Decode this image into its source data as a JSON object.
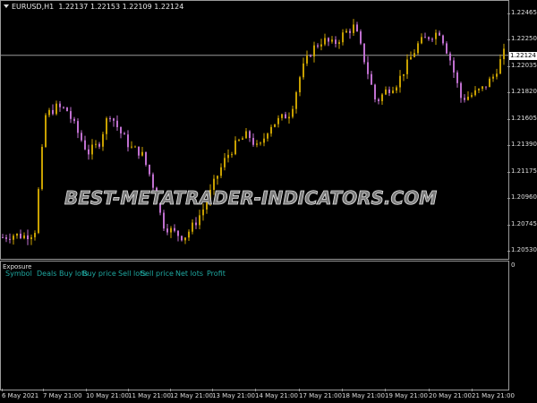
{
  "chart_data": {
    "type": "candlestick",
    "title": "EURUSD,H1",
    "ohlc_readout": [
      "1.22137",
      "1.22153",
      "1.22109",
      "1.22124"
    ],
    "current_price": "1.22124",
    "y_ticks": [
      "1.22465",
      "1.22250",
      "1.22035",
      "1.21820",
      "1.21605",
      "1.21390",
      "1.21175",
      "1.20960",
      "1.20745",
      "1.20530"
    ],
    "ylim": [
      1.2053,
      1.22465
    ],
    "x_ticks": [
      "6 May 2021",
      "7 May 21:00",
      "10 May 21:00",
      "11 May 21:00",
      "12 May 21:00",
      "13 May 21:00",
      "14 May 21:00",
      "17 May 21:00",
      "18 May 21:00",
      "19 May 21:00",
      "20 May 21:00",
      "21 May 21:00"
    ],
    "close_path": [
      1.2064,
      1.2066,
      1.2065,
      1.2068,
      1.2163,
      1.217,
      1.2168,
      1.215,
      1.2133,
      1.214,
      1.2166,
      1.215,
      1.2137,
      1.2133,
      1.211,
      1.2075,
      1.2068,
      1.2064,
      1.2075,
      1.209,
      1.2112,
      1.213,
      1.2141,
      1.2148,
      1.2135,
      1.2155,
      1.216,
      1.2166,
      1.2199,
      1.2217,
      1.2225,
      1.2221,
      1.223,
      1.2236,
      1.2206,
      1.2174,
      1.2184,
      1.219,
      1.2206,
      1.2222,
      1.2228,
      1.2232,
      1.2208,
      1.2177,
      1.218,
      1.2185,
      1.2195,
      1.2214
    ],
    "colors": {
      "bull": "#c8a000",
      "bear": "#c070d0",
      "background": "#000000",
      "grid": "#9a9a9a"
    }
  },
  "watermark": "BEST-METATRADER-INDICATORS.COM",
  "subwindow": {
    "title": "Exposure",
    "scale_label": "0",
    "columns": [
      "Symbol",
      "Deals",
      "Buy lots",
      "Buy price",
      "Sell lots",
      "Sell price",
      "Net lots",
      "Profit"
    ]
  }
}
